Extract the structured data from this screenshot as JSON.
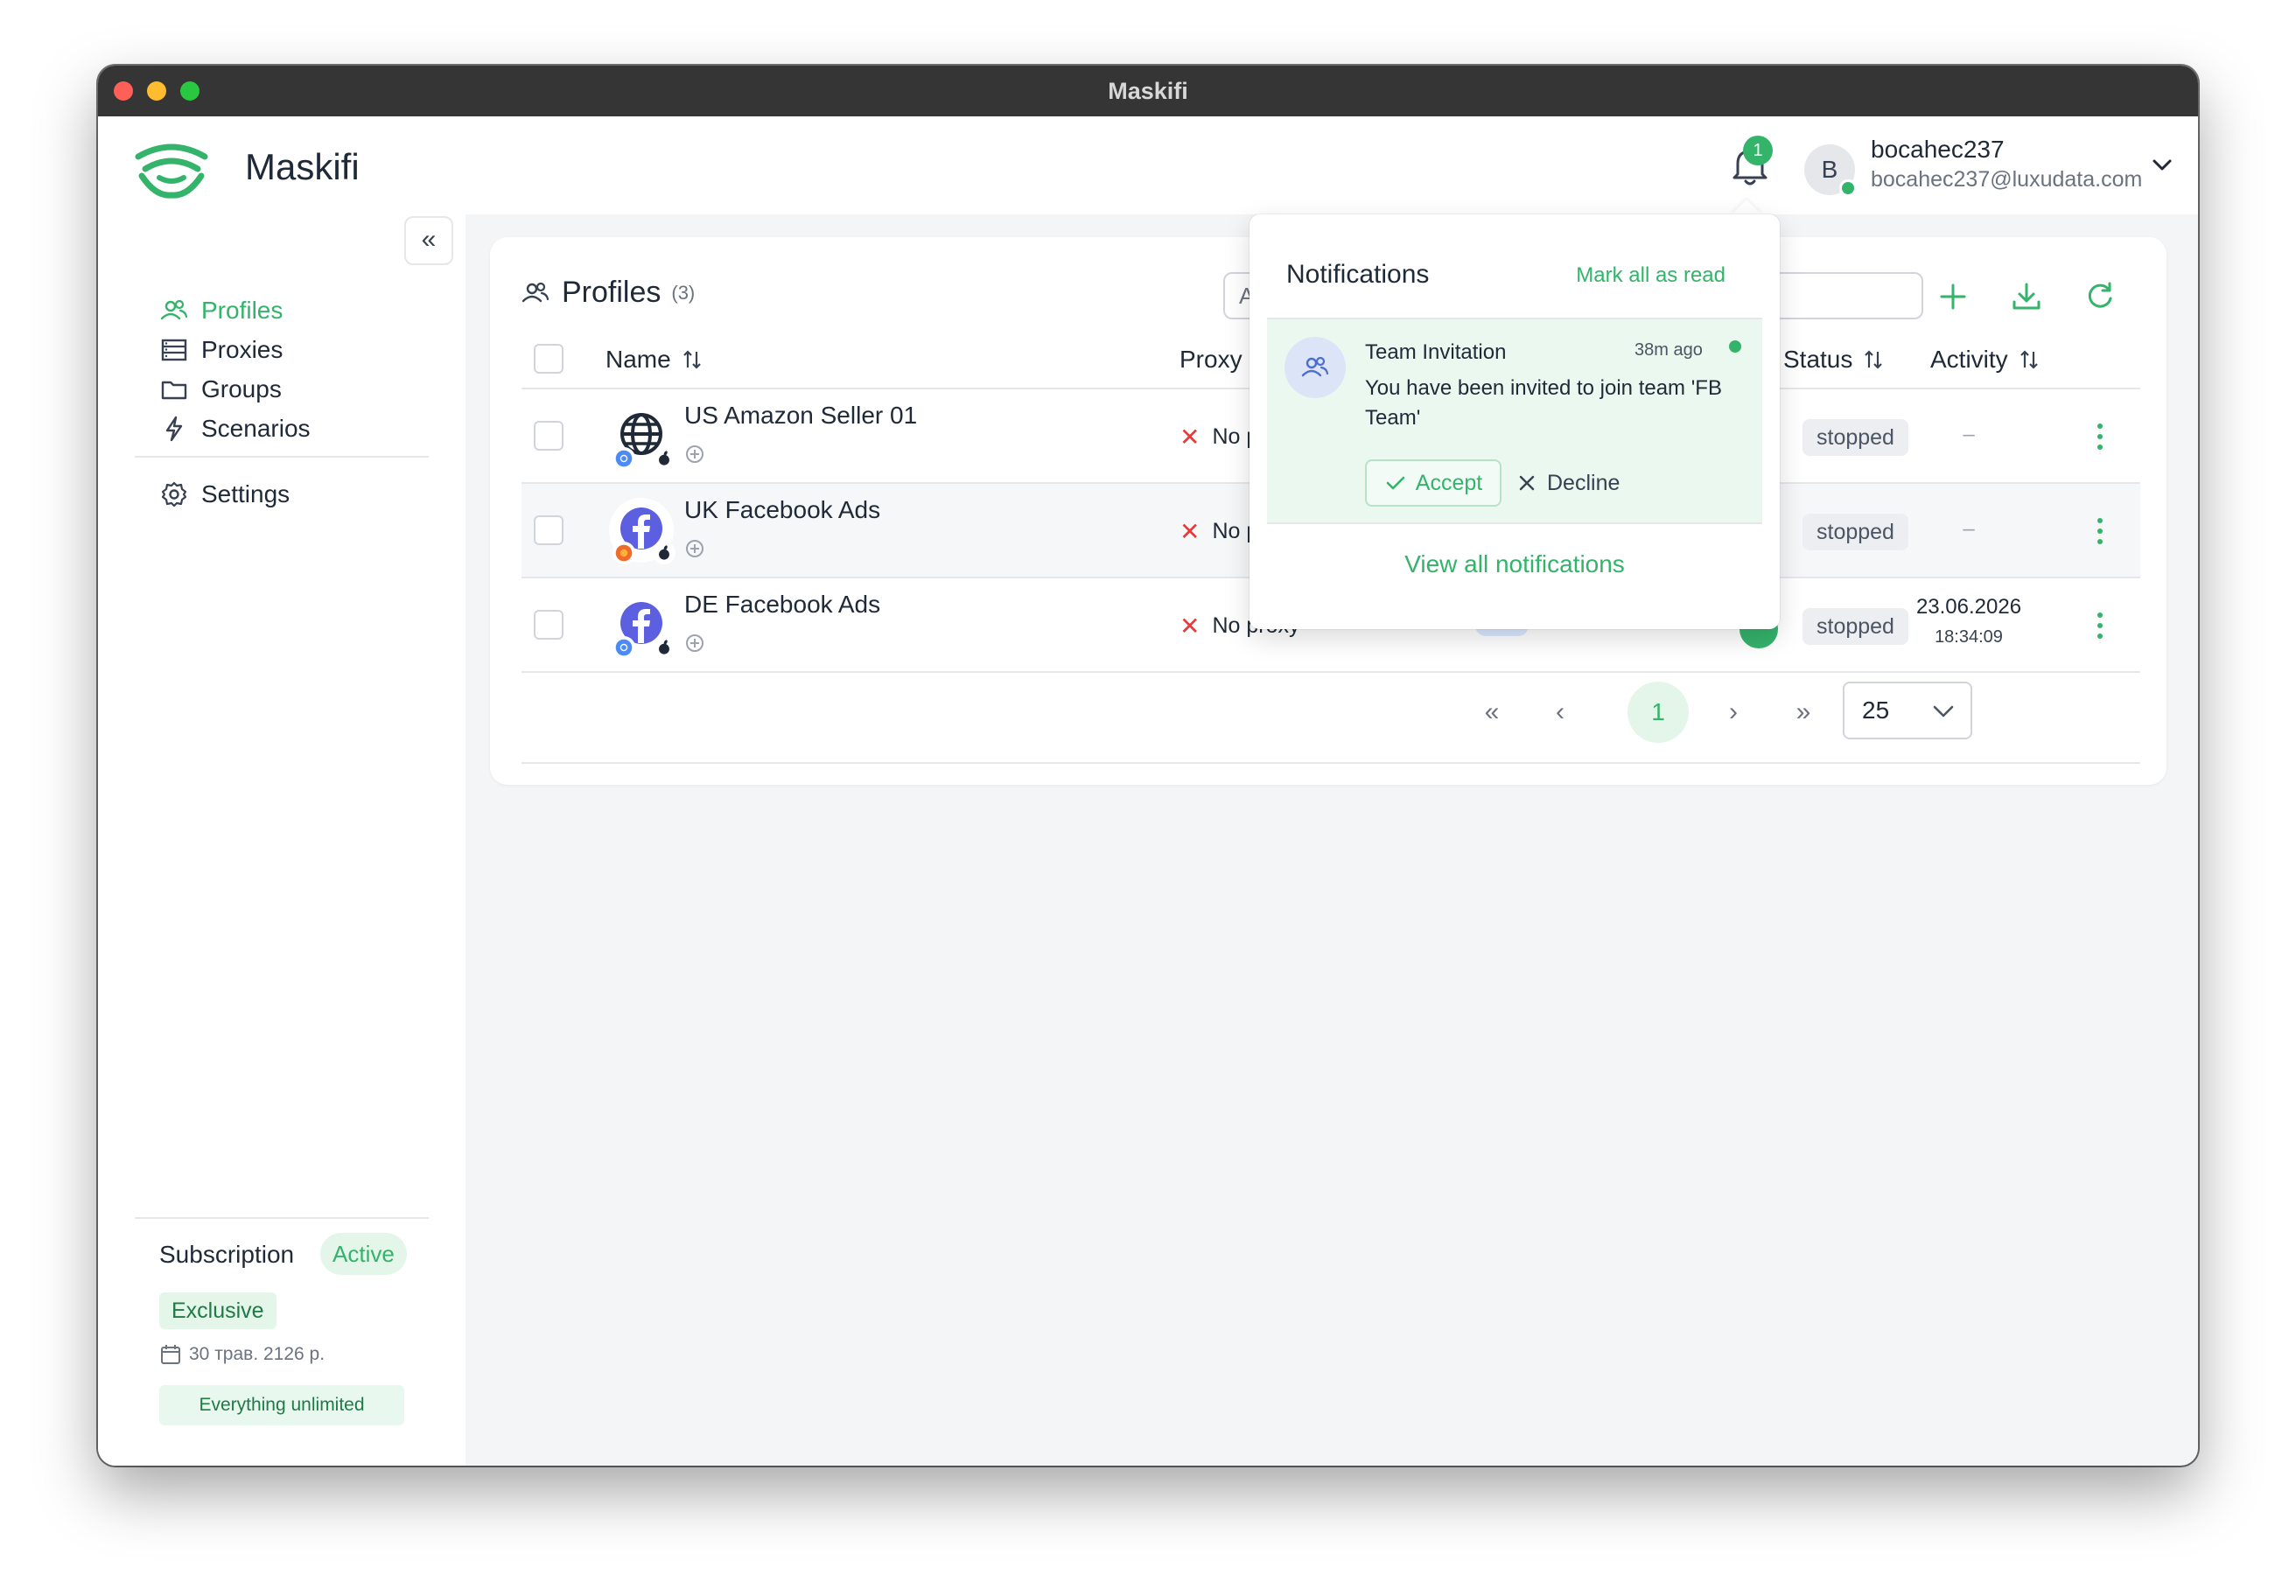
{
  "window": {
    "title": "Maskifi"
  },
  "header": {
    "app_name": "Maskifi",
    "notification_count": "1",
    "user": {
      "initial": "B",
      "name": "bocahec237",
      "email": "bocahec237@luxudata.com"
    }
  },
  "sidebar": {
    "collapse_label": "«",
    "items": [
      {
        "label": "Profiles",
        "icon": "users-icon",
        "active": true
      },
      {
        "label": "Proxies",
        "icon": "server-icon",
        "active": false
      },
      {
        "label": "Groups",
        "icon": "folder-icon",
        "active": false
      },
      {
        "label": "Scenarios",
        "icon": "lightning-icon",
        "active": false
      },
      {
        "label": "Settings",
        "icon": "gear-icon",
        "active": false
      }
    ],
    "subscription": {
      "title": "Subscription",
      "status": "Active",
      "plan": "Exclusive",
      "date": "30 трав. 2126 р.",
      "note": "Everything unlimited"
    }
  },
  "profiles": {
    "title": "Profiles",
    "count": "(3)",
    "search_text": "A",
    "columns": {
      "name": "Name",
      "proxy": "Proxy",
      "status": "Status",
      "activity": "Activity"
    },
    "rows": [
      {
        "name": "US Amazon Seller 01",
        "icon": "globe-icon",
        "browser": "chrome-icon",
        "os": "apple-icon",
        "proxy": "No proxy",
        "status": "stopped",
        "activity": "–"
      },
      {
        "name": "UK Facebook Ads",
        "icon": "facebook-icon",
        "browser": "firefox-icon",
        "os": "apple-icon",
        "proxy": "No proxy",
        "status": "stopped",
        "activity": "–"
      },
      {
        "name": "DE Facebook Ads",
        "icon": "facebook-icon",
        "browser": "chrome-icon",
        "os": "apple-icon",
        "proxy": "No proxy",
        "status": "stopped",
        "activity_date": "23.06.2026",
        "activity_time": "18:34:09",
        "tag": "#FB"
      }
    ],
    "pagination": {
      "current": "1",
      "page_size": "25"
    }
  },
  "notifications": {
    "title": "Notifications",
    "mark_all": "Mark all as read",
    "items": [
      {
        "title": "Team Invitation",
        "time": "38m ago",
        "body": "You have been invited to join team 'FB Team'",
        "accept": "Accept",
        "decline": "Decline"
      }
    ],
    "view_all": "View all notifications"
  },
  "colors": {
    "accent": "#34b36b",
    "danger": "#e23c3c",
    "tag": "#4b78d6"
  }
}
